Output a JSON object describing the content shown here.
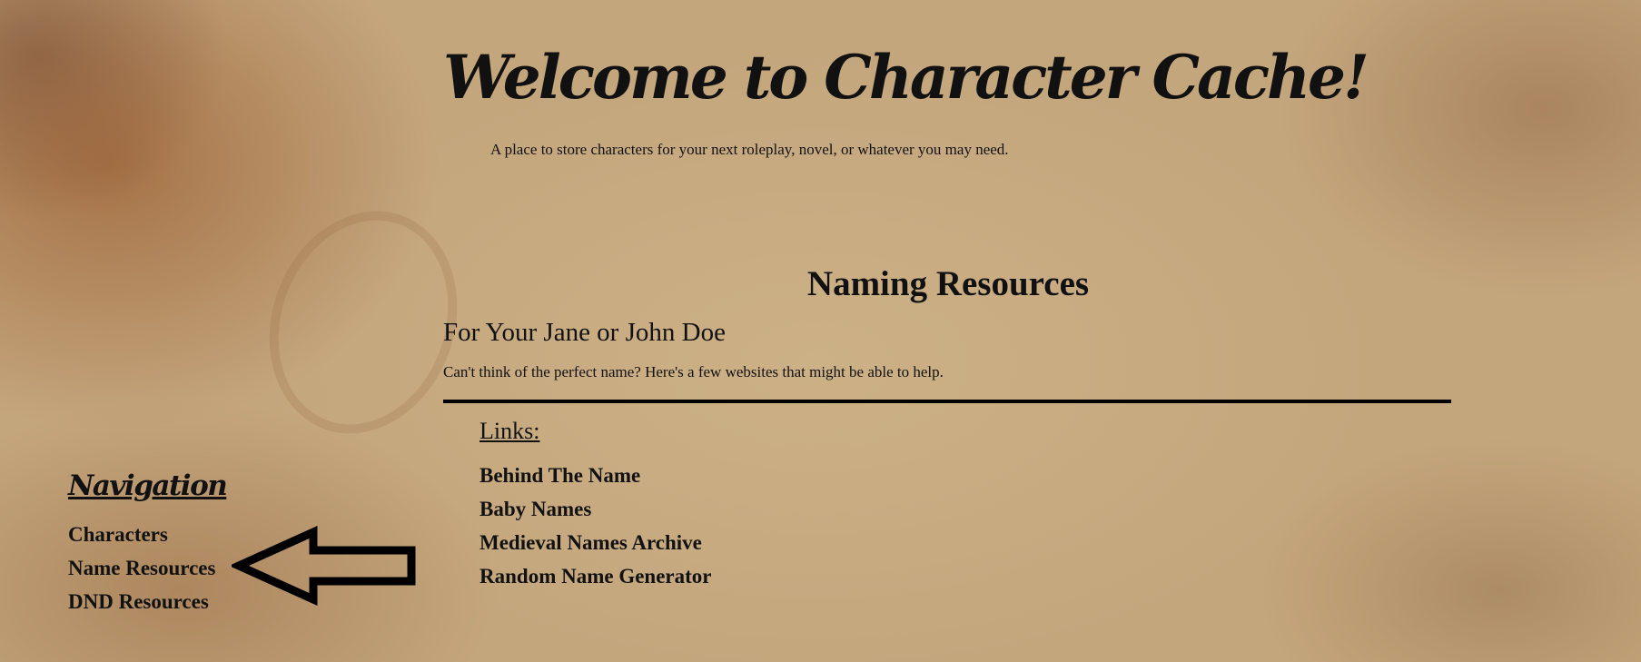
{
  "site": {
    "title": "Welcome to Character Cache!",
    "tagline": "A place to store characters for your next roleplay, novel, or whatever you may need."
  },
  "main": {
    "heading": "Naming Resources",
    "subheading": "For Your Jane or John Doe",
    "description": "Can't think of the perfect name? Here's a few websites that might be able to help.",
    "links_heading": "Links:",
    "links": [
      {
        "label": "Behind The Name"
      },
      {
        "label": "Baby Names"
      },
      {
        "label": "Medieval Names Archive"
      },
      {
        "label": "Random Name Generator"
      }
    ]
  },
  "nav": {
    "title": "Navigation",
    "items": [
      {
        "label": "Characters"
      },
      {
        "label": "Name Resources"
      },
      {
        "label": "DND Resources"
      }
    ],
    "current_item": "Name Resources",
    "indicator_icon": "left-arrow-icon"
  }
}
